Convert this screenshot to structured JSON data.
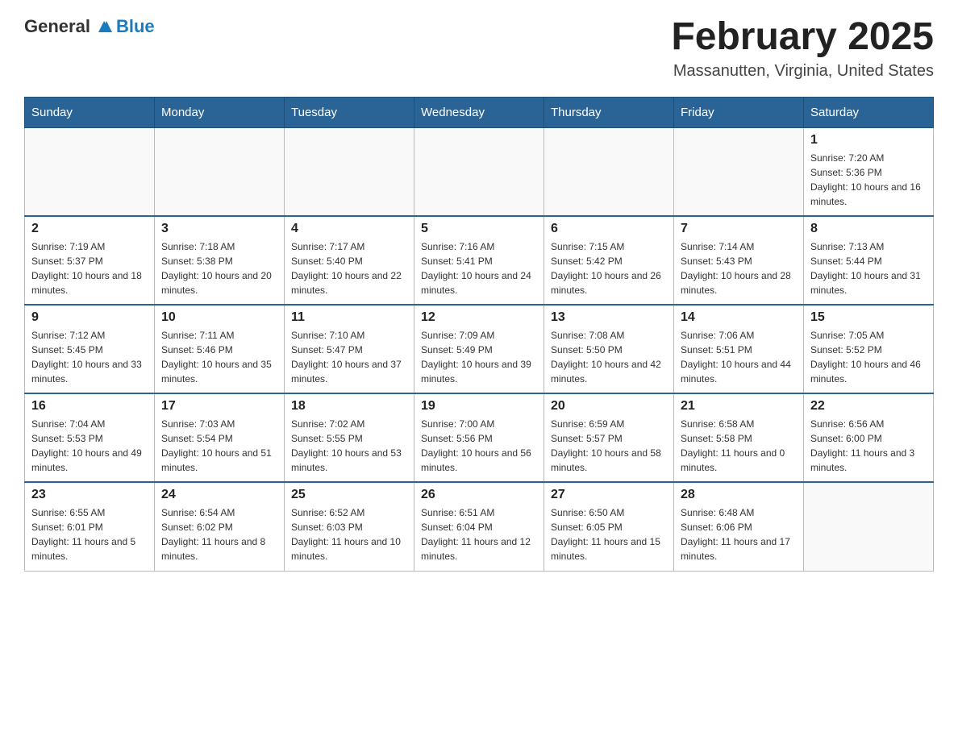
{
  "header": {
    "logo_general": "General",
    "logo_blue": "Blue",
    "month_title": "February 2025",
    "location": "Massanutten, Virginia, United States"
  },
  "weekdays": [
    "Sunday",
    "Monday",
    "Tuesday",
    "Wednesday",
    "Thursday",
    "Friday",
    "Saturday"
  ],
  "weeks": [
    [
      {
        "day": "",
        "sunrise": "",
        "sunset": "",
        "daylight": ""
      },
      {
        "day": "",
        "sunrise": "",
        "sunset": "",
        "daylight": ""
      },
      {
        "day": "",
        "sunrise": "",
        "sunset": "",
        "daylight": ""
      },
      {
        "day": "",
        "sunrise": "",
        "sunset": "",
        "daylight": ""
      },
      {
        "day": "",
        "sunrise": "",
        "sunset": "",
        "daylight": ""
      },
      {
        "day": "",
        "sunrise": "",
        "sunset": "",
        "daylight": ""
      },
      {
        "day": "1",
        "sunrise": "Sunrise: 7:20 AM",
        "sunset": "Sunset: 5:36 PM",
        "daylight": "Daylight: 10 hours and 16 minutes."
      }
    ],
    [
      {
        "day": "2",
        "sunrise": "Sunrise: 7:19 AM",
        "sunset": "Sunset: 5:37 PM",
        "daylight": "Daylight: 10 hours and 18 minutes."
      },
      {
        "day": "3",
        "sunrise": "Sunrise: 7:18 AM",
        "sunset": "Sunset: 5:38 PM",
        "daylight": "Daylight: 10 hours and 20 minutes."
      },
      {
        "day": "4",
        "sunrise": "Sunrise: 7:17 AM",
        "sunset": "Sunset: 5:40 PM",
        "daylight": "Daylight: 10 hours and 22 minutes."
      },
      {
        "day": "5",
        "sunrise": "Sunrise: 7:16 AM",
        "sunset": "Sunset: 5:41 PM",
        "daylight": "Daylight: 10 hours and 24 minutes."
      },
      {
        "day": "6",
        "sunrise": "Sunrise: 7:15 AM",
        "sunset": "Sunset: 5:42 PM",
        "daylight": "Daylight: 10 hours and 26 minutes."
      },
      {
        "day": "7",
        "sunrise": "Sunrise: 7:14 AM",
        "sunset": "Sunset: 5:43 PM",
        "daylight": "Daylight: 10 hours and 28 minutes."
      },
      {
        "day": "8",
        "sunrise": "Sunrise: 7:13 AM",
        "sunset": "Sunset: 5:44 PM",
        "daylight": "Daylight: 10 hours and 31 minutes."
      }
    ],
    [
      {
        "day": "9",
        "sunrise": "Sunrise: 7:12 AM",
        "sunset": "Sunset: 5:45 PM",
        "daylight": "Daylight: 10 hours and 33 minutes."
      },
      {
        "day": "10",
        "sunrise": "Sunrise: 7:11 AM",
        "sunset": "Sunset: 5:46 PM",
        "daylight": "Daylight: 10 hours and 35 minutes."
      },
      {
        "day": "11",
        "sunrise": "Sunrise: 7:10 AM",
        "sunset": "Sunset: 5:47 PM",
        "daylight": "Daylight: 10 hours and 37 minutes."
      },
      {
        "day": "12",
        "sunrise": "Sunrise: 7:09 AM",
        "sunset": "Sunset: 5:49 PM",
        "daylight": "Daylight: 10 hours and 39 minutes."
      },
      {
        "day": "13",
        "sunrise": "Sunrise: 7:08 AM",
        "sunset": "Sunset: 5:50 PM",
        "daylight": "Daylight: 10 hours and 42 minutes."
      },
      {
        "day": "14",
        "sunrise": "Sunrise: 7:06 AM",
        "sunset": "Sunset: 5:51 PM",
        "daylight": "Daylight: 10 hours and 44 minutes."
      },
      {
        "day": "15",
        "sunrise": "Sunrise: 7:05 AM",
        "sunset": "Sunset: 5:52 PM",
        "daylight": "Daylight: 10 hours and 46 minutes."
      }
    ],
    [
      {
        "day": "16",
        "sunrise": "Sunrise: 7:04 AM",
        "sunset": "Sunset: 5:53 PM",
        "daylight": "Daylight: 10 hours and 49 minutes."
      },
      {
        "day": "17",
        "sunrise": "Sunrise: 7:03 AM",
        "sunset": "Sunset: 5:54 PM",
        "daylight": "Daylight: 10 hours and 51 minutes."
      },
      {
        "day": "18",
        "sunrise": "Sunrise: 7:02 AM",
        "sunset": "Sunset: 5:55 PM",
        "daylight": "Daylight: 10 hours and 53 minutes."
      },
      {
        "day": "19",
        "sunrise": "Sunrise: 7:00 AM",
        "sunset": "Sunset: 5:56 PM",
        "daylight": "Daylight: 10 hours and 56 minutes."
      },
      {
        "day": "20",
        "sunrise": "Sunrise: 6:59 AM",
        "sunset": "Sunset: 5:57 PM",
        "daylight": "Daylight: 10 hours and 58 minutes."
      },
      {
        "day": "21",
        "sunrise": "Sunrise: 6:58 AM",
        "sunset": "Sunset: 5:58 PM",
        "daylight": "Daylight: 11 hours and 0 minutes."
      },
      {
        "day": "22",
        "sunrise": "Sunrise: 6:56 AM",
        "sunset": "Sunset: 6:00 PM",
        "daylight": "Daylight: 11 hours and 3 minutes."
      }
    ],
    [
      {
        "day": "23",
        "sunrise": "Sunrise: 6:55 AM",
        "sunset": "Sunset: 6:01 PM",
        "daylight": "Daylight: 11 hours and 5 minutes."
      },
      {
        "day": "24",
        "sunrise": "Sunrise: 6:54 AM",
        "sunset": "Sunset: 6:02 PM",
        "daylight": "Daylight: 11 hours and 8 minutes."
      },
      {
        "day": "25",
        "sunrise": "Sunrise: 6:52 AM",
        "sunset": "Sunset: 6:03 PM",
        "daylight": "Daylight: 11 hours and 10 minutes."
      },
      {
        "day": "26",
        "sunrise": "Sunrise: 6:51 AM",
        "sunset": "Sunset: 6:04 PM",
        "daylight": "Daylight: 11 hours and 12 minutes."
      },
      {
        "day": "27",
        "sunrise": "Sunrise: 6:50 AM",
        "sunset": "Sunset: 6:05 PM",
        "daylight": "Daylight: 11 hours and 15 minutes."
      },
      {
        "day": "28",
        "sunrise": "Sunrise: 6:48 AM",
        "sunset": "Sunset: 6:06 PM",
        "daylight": "Daylight: 11 hours and 17 minutes."
      },
      {
        "day": "",
        "sunrise": "",
        "sunset": "",
        "daylight": ""
      }
    ]
  ]
}
